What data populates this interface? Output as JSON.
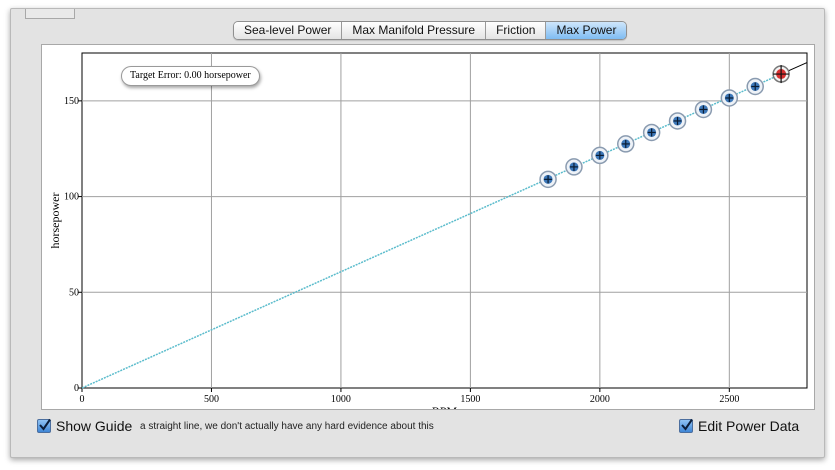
{
  "tabs": [
    {
      "label": "Sea-level Power",
      "active": false
    },
    {
      "label": "Max Manifold Pressure",
      "active": false
    },
    {
      "label": "Friction",
      "active": false
    },
    {
      "label": "Max Power",
      "active": true
    }
  ],
  "badge": {
    "text": "Target Error: 0.00 horsepower"
  },
  "footer": {
    "show_guide_label": "Show Guide",
    "show_guide_checked": true,
    "guide_note": "a straight line, we don't actually have any hard evidence about this",
    "edit_power_label": "Edit Power Data",
    "edit_power_checked": true
  },
  "colors": {
    "guide_line": "#5bbccc",
    "point_fill": "#3c77b8",
    "target_fill": "#d93030",
    "active_tab": "#7fbcf2"
  },
  "chart_data": {
    "type": "line",
    "xlabel": "RPM",
    "ylabel": "horsepower",
    "xlim": [
      0,
      2800
    ],
    "ylim": [
      0,
      175
    ],
    "xticks": [
      0,
      500,
      1000,
      1500,
      2000,
      2500
    ],
    "yticks": [
      0,
      50,
      100,
      150
    ],
    "grid": true,
    "guide_line": {
      "x": [
        0,
        2700
      ],
      "y": [
        0,
        164
      ]
    },
    "series": [
      {
        "x": [
          1800,
          1900,
          2000,
          2100,
          2200,
          2300,
          2400,
          2500,
          2600
        ],
        "y": [
          109,
          115.5,
          121.5,
          127.5,
          133.5,
          139.5,
          145.5,
          151.5,
          157.5
        ]
      }
    ],
    "target_point": {
      "x": 2700,
      "y": 164
    },
    "target_extension": {
      "x": [
        2700,
        2800
      ],
      "y": [
        164,
        170
      ]
    }
  }
}
